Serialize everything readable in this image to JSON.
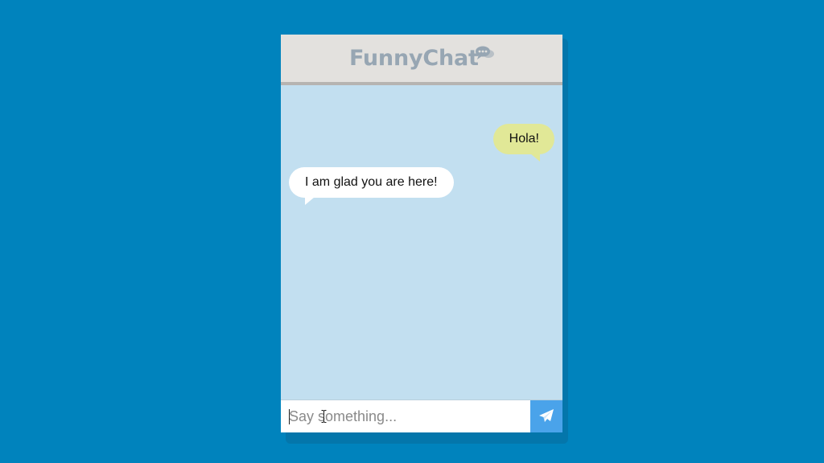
{
  "app": {
    "title": "FunnyChat",
    "title_icon": "chat-bubbles-icon"
  },
  "messages": [
    {
      "from": "me",
      "text": "Hola!"
    },
    {
      "from": "other",
      "text": "I am glad you are here!"
    }
  ],
  "composer": {
    "placeholder": "Say something...",
    "value": "",
    "send_icon": "paper-plane-icon"
  },
  "colors": {
    "page_background": "#0083bd",
    "header_background": "#e3e1de",
    "title_text": "#97a6b3",
    "chat_background": "#c2dff0",
    "sent_bubble": "#e1e897",
    "received_bubble": "#ffffff",
    "send_button": "#4aa3ea"
  }
}
